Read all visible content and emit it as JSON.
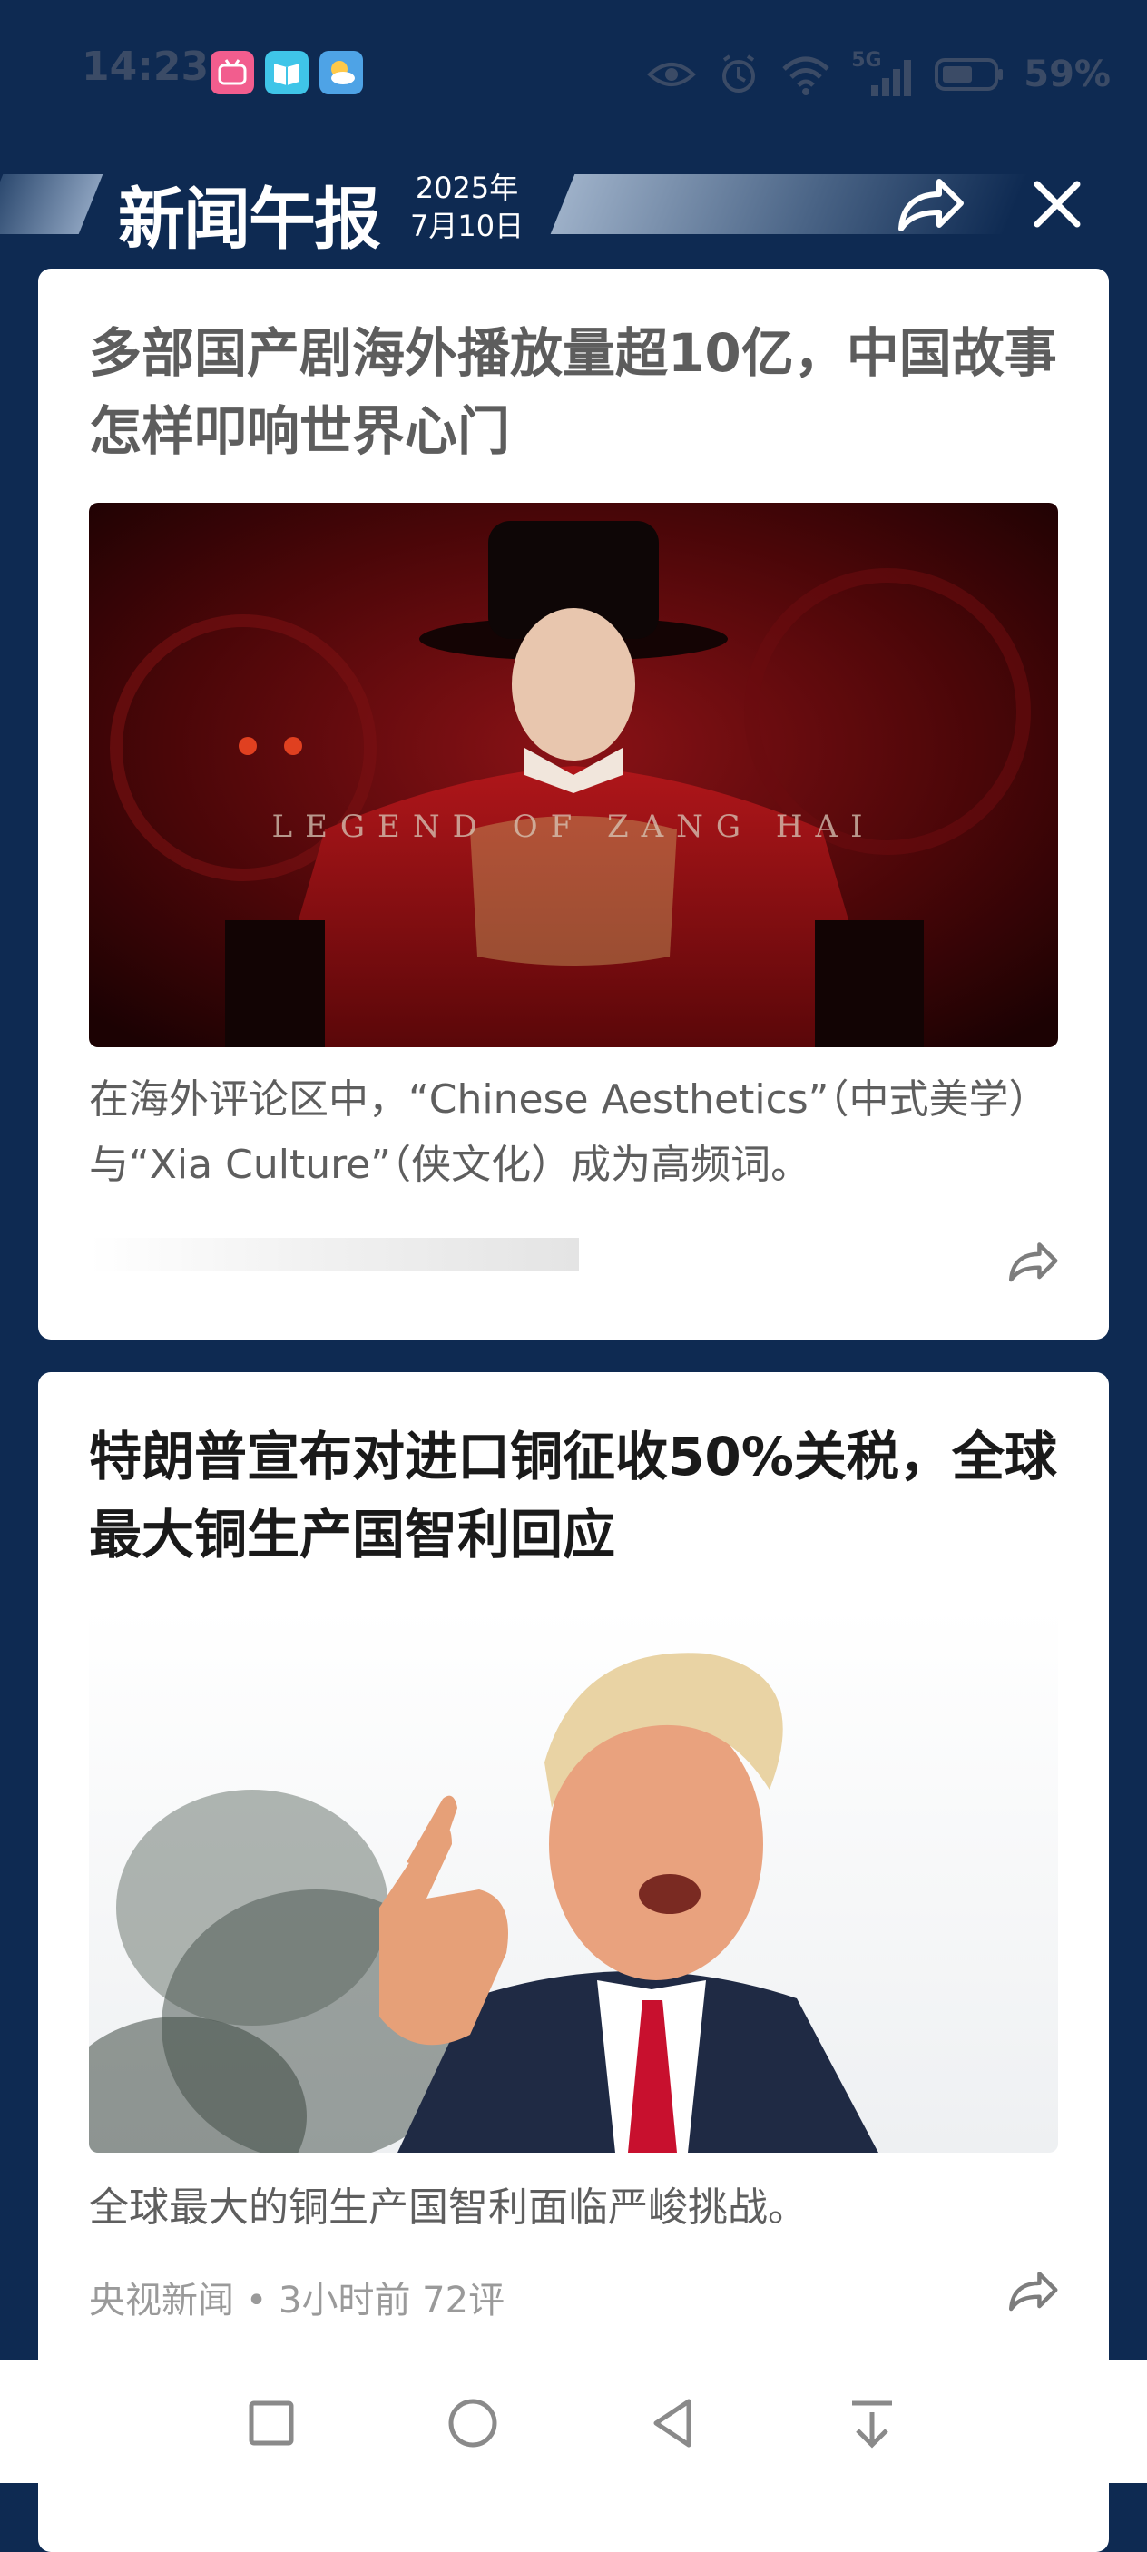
{
  "status_bar": {
    "time": "14:23",
    "battery": "59%",
    "network": "5G",
    "apps": [
      "bilibili-icon",
      "reader-icon",
      "weather-icon"
    ]
  },
  "header": {
    "brand": "新闻午报",
    "date_year": "2025年",
    "date_day": "7月10日"
  },
  "cards": [
    {
      "title": "多部国产剧海外播放量超10亿，中国故事怎样叩响世界心门",
      "image_caption": "LEGEND OF ZANG HAI",
      "summary": "在海外评论区中，“Chinese Aesthetics”（中式美学）与“Xia Culture”（侠文化）成为高频词。",
      "meta": ""
    },
    {
      "title": "特朗普宣布对进口铜征收50%关税，全球最大铜生产国智利回应",
      "summary": "全球最大的铜生产国智利面临严峻挑战。",
      "meta": "央视新闻 • 3小时前  72评"
    }
  ],
  "colors": {
    "background": "#0e2a52",
    "card": "#ffffff",
    "tie_red": "#c8102e"
  }
}
